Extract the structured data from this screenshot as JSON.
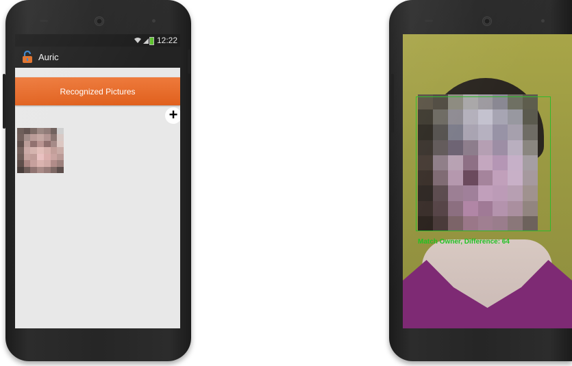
{
  "left_phone": {
    "status": {
      "time": "12:22"
    },
    "app": {
      "title": "Auric",
      "icon": "lock-icon"
    },
    "recognized_button_label": "Recognized Pictures",
    "add_button": {
      "icon": "plus-icon",
      "label": "+"
    },
    "thumbnail": {
      "icon": "face-photo"
    }
  },
  "right_phone": {
    "match_label": "Match Owner, Difference: 64"
  },
  "colors": {
    "accent_orange": "#e8692a",
    "detection_green": "#2dbb2b"
  }
}
